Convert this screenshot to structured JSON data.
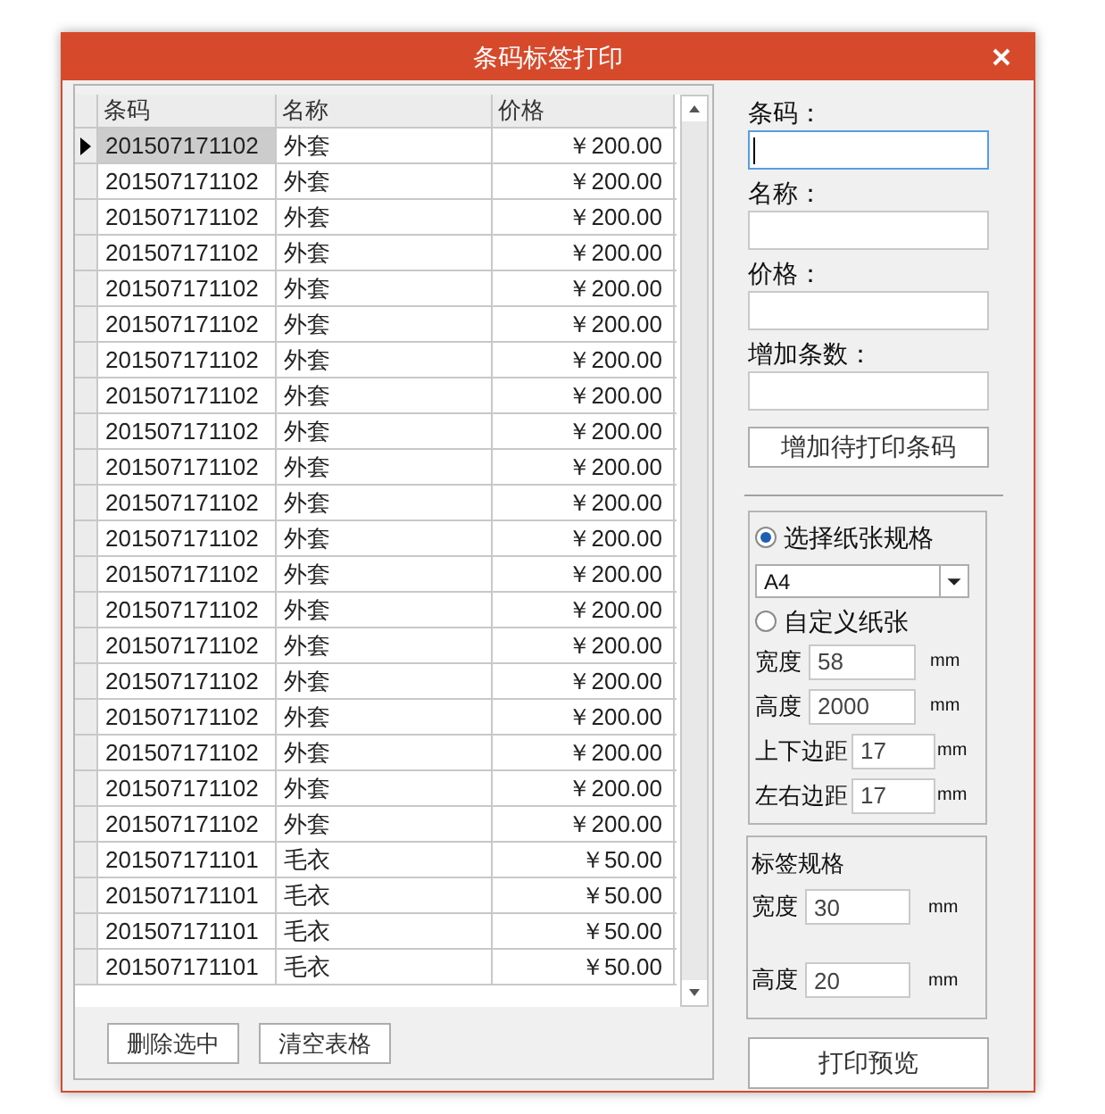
{
  "window": {
    "title": "条码标签打印"
  },
  "table": {
    "columns": [
      "条码",
      "名称",
      "价格"
    ],
    "rows": [
      {
        "barcode": "201507171102",
        "name": "外套",
        "price": "￥200.00",
        "selected": true
      },
      {
        "barcode": "201507171102",
        "name": "外套",
        "price": "￥200.00",
        "selected": false
      },
      {
        "barcode": "201507171102",
        "name": "外套",
        "price": "￥200.00",
        "selected": false
      },
      {
        "barcode": "201507171102",
        "name": "外套",
        "price": "￥200.00",
        "selected": false
      },
      {
        "barcode": "201507171102",
        "name": "外套",
        "price": "￥200.00",
        "selected": false
      },
      {
        "barcode": "201507171102",
        "name": "外套",
        "price": "￥200.00",
        "selected": false
      },
      {
        "barcode": "201507171102",
        "name": "外套",
        "price": "￥200.00",
        "selected": false
      },
      {
        "barcode": "201507171102",
        "name": "外套",
        "price": "￥200.00",
        "selected": false
      },
      {
        "barcode": "201507171102",
        "name": "外套",
        "price": "￥200.00",
        "selected": false
      },
      {
        "barcode": "201507171102",
        "name": "外套",
        "price": "￥200.00",
        "selected": false
      },
      {
        "barcode": "201507171102",
        "name": "外套",
        "price": "￥200.00",
        "selected": false
      },
      {
        "barcode": "201507171102",
        "name": "外套",
        "price": "￥200.00",
        "selected": false
      },
      {
        "barcode": "201507171102",
        "name": "外套",
        "price": "￥200.00",
        "selected": false
      },
      {
        "barcode": "201507171102",
        "name": "外套",
        "price": "￥200.00",
        "selected": false
      },
      {
        "barcode": "201507171102",
        "name": "外套",
        "price": "￥200.00",
        "selected": false
      },
      {
        "barcode": "201507171102",
        "name": "外套",
        "price": "￥200.00",
        "selected": false
      },
      {
        "barcode": "201507171102",
        "name": "外套",
        "price": "￥200.00",
        "selected": false
      },
      {
        "barcode": "201507171102",
        "name": "外套",
        "price": "￥200.00",
        "selected": false
      },
      {
        "barcode": "201507171102",
        "name": "外套",
        "price": "￥200.00",
        "selected": false
      },
      {
        "barcode": "201507171102",
        "name": "外套",
        "price": "￥200.00",
        "selected": false
      },
      {
        "barcode": "201507171101",
        "name": "毛衣",
        "price": "￥50.00",
        "selected": false
      },
      {
        "barcode": "201507171101",
        "name": "毛衣",
        "price": "￥50.00",
        "selected": false
      },
      {
        "barcode": "201507171101",
        "name": "毛衣",
        "price": "￥50.00",
        "selected": false
      },
      {
        "barcode": "201507171101",
        "name": "毛衣",
        "price": "￥50.00",
        "selected": false
      }
    ]
  },
  "table_buttons": [
    "删除选中",
    "清空表格"
  ],
  "form": {
    "fields": [
      {
        "label": "条码：",
        "focused": true
      },
      {
        "label": "名称：",
        "focused": false
      },
      {
        "label": "价格：",
        "focused": false
      },
      {
        "label": "增加条数：",
        "focused": false
      }
    ],
    "add_button": "增加待打印条码"
  },
  "paper": {
    "options": [
      {
        "label": "选择纸张规格",
        "selected": true
      },
      {
        "label": "自定义纸张",
        "selected": false
      }
    ],
    "size": "A4",
    "fields": [
      {
        "label": "宽度",
        "value": "58",
        "unit": "mm"
      },
      {
        "label": "高度",
        "value": "2000",
        "unit": "mm"
      },
      {
        "label": "上下边距",
        "value": "17",
        "unit": "mm"
      },
      {
        "label": "左右边距",
        "value": "17",
        "unit": "mm"
      }
    ]
  },
  "label_spec": {
    "title": "标签规格",
    "fields": [
      {
        "label": "宽度",
        "value": "30",
        "unit": "mm"
      },
      {
        "label": "高度",
        "value": "20",
        "unit": "mm"
      }
    ]
  },
  "preview_button": "打印预览"
}
